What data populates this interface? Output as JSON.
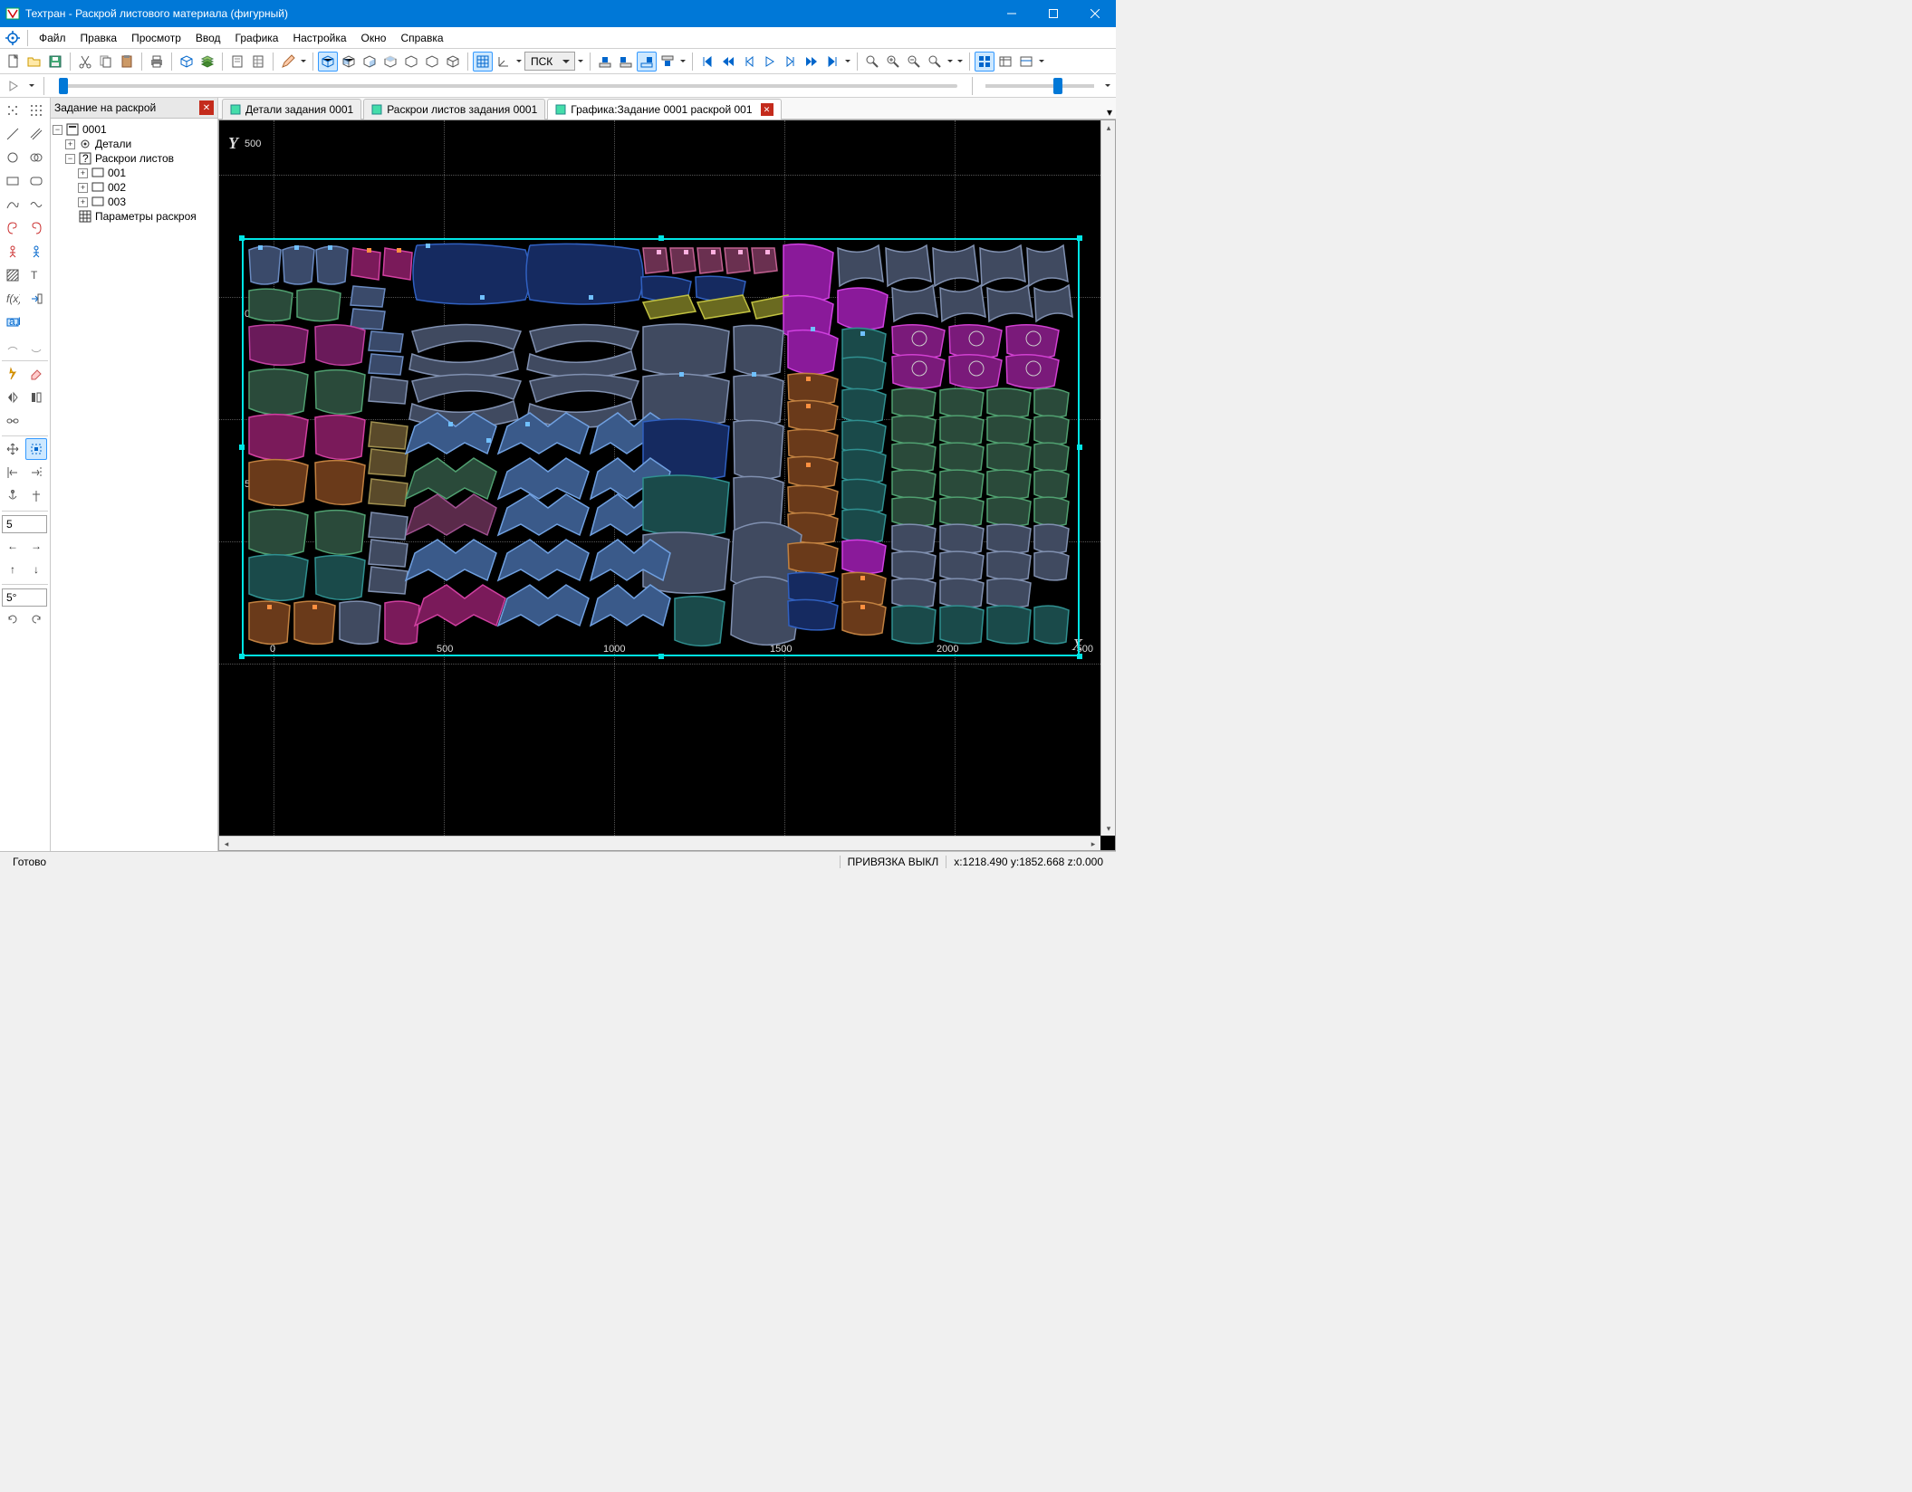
{
  "window": {
    "title": "Техтран - Раскрой листового материала (фигурный)"
  },
  "menu": {
    "file": "Файл",
    "edit": "Правка",
    "view": "Просмотр",
    "input": "Ввод",
    "graphics": "Графика",
    "settings": "Настройка",
    "window": "Окно",
    "help": "Справка"
  },
  "combo": {
    "ucs": "ПСК"
  },
  "panel": {
    "title": "Задание на раскрой"
  },
  "tree": {
    "root": "0001",
    "details": "Детали",
    "layouts": "Раскрои листов",
    "sheet1": "001",
    "sheet2": "002",
    "sheet3": "003",
    "params": "Параметры раскроя"
  },
  "tabs": {
    "t1": "Детали задания 0001",
    "t2": "Раскрои листов задания 0001",
    "t3": "Графика:Задание 0001 раскрой 001"
  },
  "left_input": {
    "val1": "5",
    "val2": "5°"
  },
  "axes": {
    "y": "Y",
    "y_tick1": "500",
    "y_tick2": "000",
    "y_tick3": "500",
    "x": "X",
    "x_tick0": "0",
    "x_tick1": "500",
    "x_tick2": "1000",
    "x_tick3": "1500",
    "x_tick4": "2000",
    "x_tick5": "500"
  },
  "status": {
    "ready": "Готово",
    "snap": "ПРИВЯЗКА ВЫКЛ",
    "coords": "x:1218.490 y:1852.668 z:0.000"
  }
}
